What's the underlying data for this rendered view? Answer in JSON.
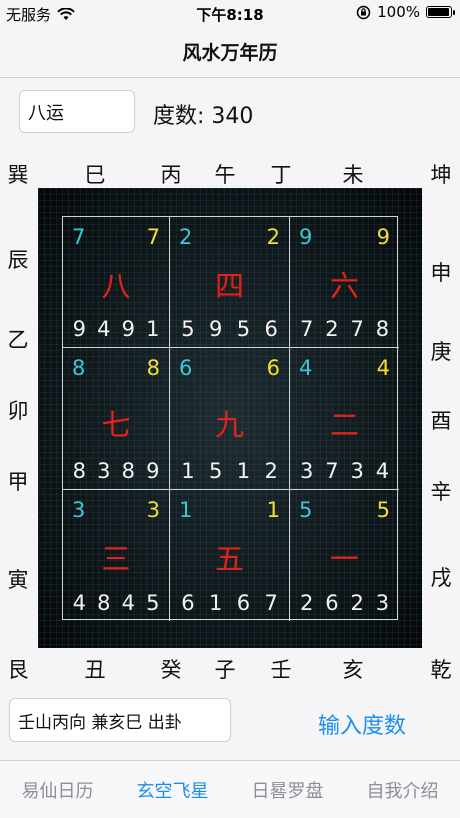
{
  "status": {
    "carrier": "无服务",
    "time": "下午8:18",
    "battery": "100%",
    "battery_level": 1.0
  },
  "nav": {
    "title": "风水万年历"
  },
  "period_input": {
    "value": "八运"
  },
  "degree": {
    "label": "度数: 340"
  },
  "directions": {
    "top": [
      "巽",
      "巳",
      "丙",
      "午",
      "丁",
      "未",
      "坤"
    ],
    "bottom": [
      "艮",
      "丑",
      "癸",
      "子",
      "壬",
      "亥",
      "乾"
    ],
    "left": [
      "辰",
      "乙",
      "卯",
      "甲",
      "寅"
    ],
    "right": [
      "申",
      "庚",
      "酉",
      "辛",
      "戌"
    ]
  },
  "grid": [
    {
      "mountain": "7",
      "water": "7",
      "star": "八",
      "numbers": [
        "9",
        "4",
        "9",
        "1"
      ]
    },
    {
      "mountain": "2",
      "water": "2",
      "star": "四",
      "numbers": [
        "5",
        "9",
        "5",
        "6"
      ]
    },
    {
      "mountain": "9",
      "water": "9",
      "star": "六",
      "numbers": [
        "7",
        "2",
        "7",
        "8"
      ]
    },
    {
      "mountain": "8",
      "water": "8",
      "star": "七",
      "numbers": [
        "8",
        "3",
        "8",
        "9"
      ]
    },
    {
      "mountain": "6",
      "water": "6",
      "star": "九",
      "numbers": [
        "1",
        "5",
        "1",
        "2"
      ]
    },
    {
      "mountain": "4",
      "water": "4",
      "star": "二",
      "numbers": [
        "3",
        "7",
        "3",
        "4"
      ]
    },
    {
      "mountain": "3",
      "water": "3",
      "star": "三",
      "numbers": [
        "4",
        "8",
        "4",
        "5"
      ]
    },
    {
      "mountain": "1",
      "water": "1",
      "star": "五",
      "numbers": [
        "6",
        "1",
        "6",
        "7"
      ]
    },
    {
      "mountain": "5",
      "water": "5",
      "star": "一",
      "numbers": [
        "2",
        "6",
        "2",
        "3"
      ]
    }
  ],
  "result_field": {
    "value": "壬山丙向 兼亥巳 出卦"
  },
  "input_button": {
    "label": "输入度数"
  },
  "tabs": [
    {
      "label": "易仙日历",
      "active": false
    },
    {
      "label": "玄空飞星",
      "active": true
    },
    {
      "label": "日晷罗盘",
      "active": false
    },
    {
      "label": "自我介绍",
      "active": false
    }
  ]
}
